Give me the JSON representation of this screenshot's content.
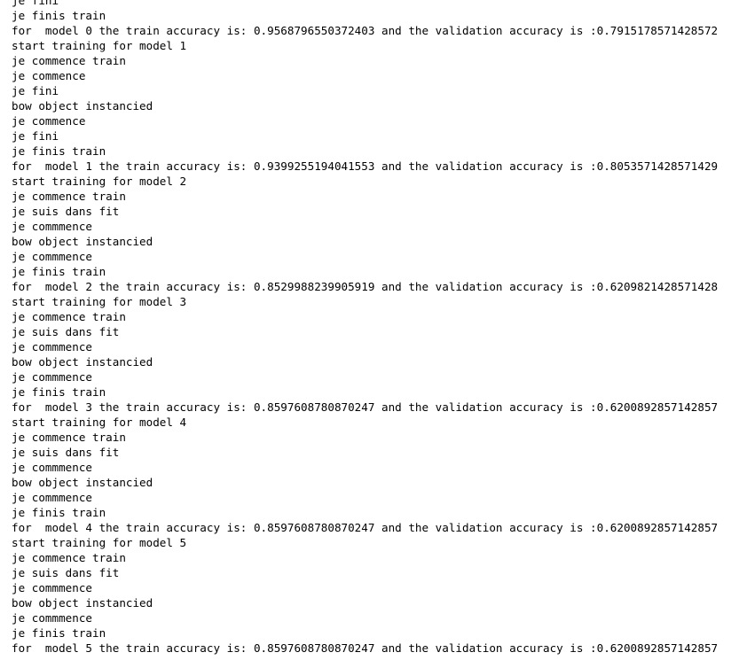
{
  "output": {
    "lines": [
      "je fini",
      "je finis train",
      "for  model 0 the train accuracy is: 0.9568796550372403 and the validation accuracy is :0.7915178571428572",
      "start training for model 1",
      "je commence train",
      "je commence",
      "je fini",
      "bow object instancied",
      "je commence",
      "je fini",
      "je finis train",
      "for  model 1 the train accuracy is: 0.9399255194041553 and the validation accuracy is :0.8053571428571429",
      "start training for model 2",
      "je commence train",
      "je suis dans fit",
      "je commmence",
      "bow object instancied",
      "je commmence",
      "je finis train",
      "for  model 2 the train accuracy is: 0.8529988239905919 and the validation accuracy is :0.6209821428571428",
      "start training for model 3",
      "je commence train",
      "je suis dans fit",
      "je commmence",
      "bow object instancied",
      "je commmence",
      "je finis train",
      "for  model 3 the train accuracy is: 0.8597608780870247 and the validation accuracy is :0.6200892857142857",
      "start training for model 4",
      "je commence train",
      "je suis dans fit",
      "je commmence",
      "bow object instancied",
      "je commmence",
      "je finis train",
      "for  model 4 the train accuracy is: 0.8597608780870247 and the validation accuracy is :0.6200892857142857",
      "start training for model 5",
      "je commence train",
      "je suis dans fit",
      "je commmence",
      "bow object instancied",
      "je commmence",
      "je finis train",
      "for  model 5 the train accuracy is: 0.8597608780870247 and the validation accuracy is :0.6200892857142857"
    ]
  }
}
